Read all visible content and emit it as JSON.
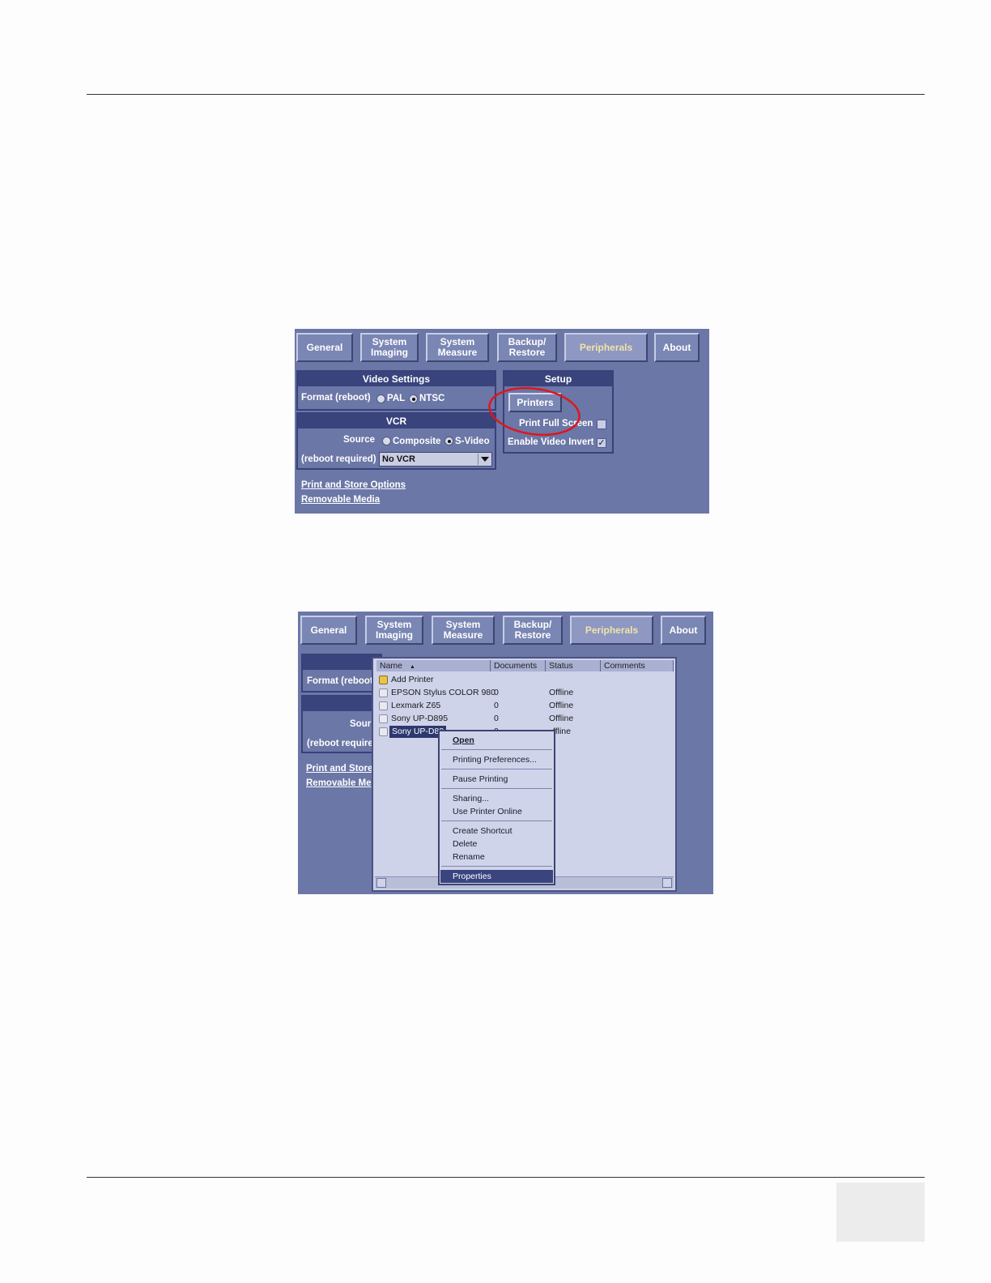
{
  "tabs": [
    "General",
    "System\nImaging",
    "System\nMeasure",
    "Backup/\nRestore",
    "Peripherals",
    "About"
  ],
  "shot1": {
    "video_settings": {
      "header": "Video Settings",
      "format_label": "Format (reboot)",
      "options": [
        "PAL",
        "NTSC"
      ],
      "selected": "NTSC"
    },
    "vcr": {
      "header": "VCR",
      "source_label": "Source",
      "source_options": [
        "Composite",
        "S-Video"
      ],
      "selected": "S-Video",
      "reboot_label": "(reboot required)",
      "vcr_value": "No VCR"
    },
    "setup": {
      "header": "Setup",
      "printers_button": "Printers",
      "print_full_screen": "Print Full Screen",
      "enable_video_invert": "Enable Video Invert",
      "print_full_screen_checked": false,
      "enable_video_invert_checked": true,
      "check_mark": "✓"
    },
    "links": [
      "Print and Store Options",
      "Removable Media"
    ]
  },
  "shot2": {
    "left_labels": {
      "format": "Format (reboot",
      "source": "Sour",
      "reboot": "(reboot require",
      "link1": "Print and Store",
      "link2": "Removable Me"
    },
    "printer_window": {
      "columns": [
        "Name",
        "Documents",
        "Status",
        "Comments"
      ],
      "sort_arrow": "▲",
      "rows": [
        {
          "name": "Add Printer",
          "documents": "",
          "status": ""
        },
        {
          "name": "EPSON Stylus COLOR 980",
          "documents": "0",
          "status": "Offline"
        },
        {
          "name": "Lexmark Z65",
          "documents": "0",
          "status": "Offline"
        },
        {
          "name": "Sony UP-D895",
          "documents": "0",
          "status": "Offline"
        },
        {
          "name": "Sony UP-D89",
          "documents": "0",
          "status": "ffline"
        }
      ]
    },
    "context_menu": [
      "Open",
      "Printing Preferences...",
      "Pause Printing",
      "Sharing...",
      "Use Printer Online",
      "Create Shortcut",
      "Delete",
      "Rename",
      "Properties"
    ]
  }
}
